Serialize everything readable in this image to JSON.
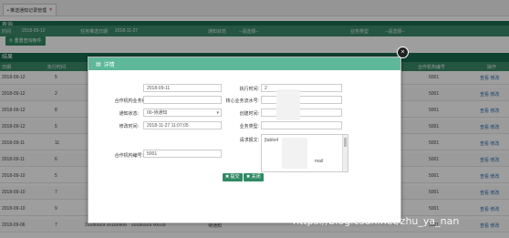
{
  "tab": {
    "label": "• 推送通知记录管理",
    "close": "×"
  },
  "page": {
    "section1_title": "查询",
    "filters": [
      "时间",
      "2018-05-12",
      "任务推送日期",
      "2018-11-27",
      "通知状态",
      "--请选择--",
      "业务类型",
      "--请选择--"
    ],
    "reset_label": "⟳ 重置查询条件",
    "section2_title": "结果",
    "columns": [
      "日期",
      "执行时间",
      "合作机构编号",
      "操作"
    ],
    "rows": [
      {
        "date": "2018-09-12",
        "exec": "5",
        "code": "5001",
        "ops": "查看 修改"
      },
      {
        "date": "2018-09-12",
        "exec": "2",
        "code": "5001",
        "ops": "查看 修改"
      },
      {
        "date": "2018-09-12",
        "exec": "8",
        "code": "5001",
        "ops": "查看 修改"
      },
      {
        "date": "2018-09-12",
        "exec": "5",
        "code": "5001",
        "ops": "查看 修改"
      },
      {
        "date": "2018-09-11",
        "exec": "11",
        "code": "5001",
        "ops": "查看 修改"
      },
      {
        "date": "2018-09-11",
        "exec": "6",
        "code": "5001",
        "ops": "查看 修改"
      },
      {
        "date": "2018-09-10",
        "exec": "5",
        "code": "5001",
        "ops": "查看 修改"
      },
      {
        "date": "2018-09-10",
        "exec": "7",
        "code": "5001",
        "ops": "查看 修改"
      },
      {
        "date": "2018-09-10",
        "exec": "9",
        "code": "5001",
        "ops": "查看 修改"
      },
      {
        "date": "2018-09-06",
        "exec": "7",
        "code": "5001",
        "ops": "查看 修改"
      }
    ],
    "last_row_extra": [
      "20180929 20180906",
      "20180929 00018",
      "待通知"
    ]
  },
  "modal": {
    "title": "详情",
    "close_glyph": "×",
    "fields": {
      "date_label": "日期:",
      "date_value": "2018-09-11",
      "exec_label": "执行时间:",
      "exec_value": "2",
      "org_label": "合作机构业务编号:",
      "center_label": "核心业务流水号:",
      "notify_label": "通知状态:",
      "notify_value": "00-待通知",
      "create_label": "创建时间:",
      "update_label": "修改时间:",
      "update_value": "2018-11-27 11:07:05",
      "biz_label": "业务类型:",
      "req_label": "请求报文:",
      "req_value": "[table4",
      "req_value2": "mail",
      "org_no_label": "合作机构编号:",
      "org_no_value": "5001"
    },
    "buttons": {
      "save": "✖ 提交",
      "close": "✖ 关闭"
    }
  },
  "watermark": "https://blog.csdn.net/zhu_ya_nan",
  "colors": {
    "header": "#5eb89a",
    "dark": "#1b6b50",
    "button": "#2f8a63"
  }
}
